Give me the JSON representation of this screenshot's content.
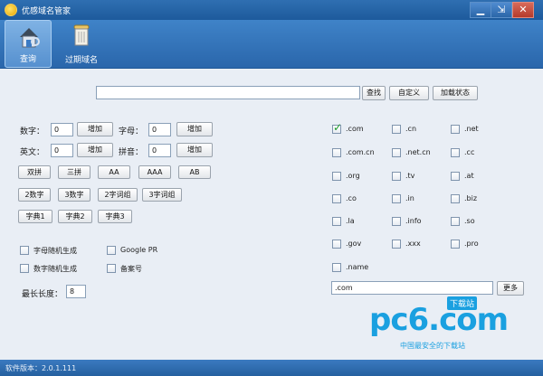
{
  "window": {
    "title": "优感域名管家",
    "min_icon": "minimize-icon",
    "restore_icon": "restore-icon",
    "close_icon": "close-icon"
  },
  "toolbar": {
    "items": [
      {
        "label": "查询",
        "icon": "house-search-icon",
        "active": true
      },
      {
        "label": "过期域名",
        "icon": "trash-can-icon",
        "active": false
      }
    ]
  },
  "search": {
    "value": "",
    "buttons": [
      "查找",
      "自定义",
      "加载状态"
    ]
  },
  "numeric": {
    "digits_label": "数字：",
    "digits_value": "0",
    "letters_label": "字母：",
    "letters_value": "0",
    "english_label": "英文：",
    "english_value": "0",
    "pinyin_label": "拼音：",
    "pinyin_value": "0",
    "add_label": "增加"
  },
  "pattern_buttons": {
    "row1": [
      "双拼",
      "三拼",
      "AA",
      "AAA",
      "AB"
    ],
    "row2": [
      "2数字",
      "3数字",
      "2字词组",
      "3字词组"
    ],
    "row3": [
      "字典1",
      "字典2",
      "字典3"
    ]
  },
  "options": {
    "random_letters": "字母随机生成",
    "random_digits": "数字随机生成",
    "google_pr": "Google PR",
    "beian": "备案号"
  },
  "max_length": {
    "label": "最长长度：",
    "value": "8"
  },
  "tlds": [
    {
      "label": ".com",
      "checked": true
    },
    {
      "label": ".cn",
      "checked": false
    },
    {
      "label": ".net",
      "checked": false
    },
    {
      "label": ".com.cn",
      "checked": false
    },
    {
      "label": ".net.cn",
      "checked": false
    },
    {
      "label": ".cc",
      "checked": false
    },
    {
      "label": ".org",
      "checked": false
    },
    {
      "label": ".tv",
      "checked": false
    },
    {
      "label": ".at",
      "checked": false
    },
    {
      "label": ".co",
      "checked": false
    },
    {
      "label": ".in",
      "checked": false
    },
    {
      "label": ".biz",
      "checked": false
    },
    {
      "label": ".la",
      "checked": false
    },
    {
      "label": ".info",
      "checked": false
    },
    {
      "label": ".so",
      "checked": false
    },
    {
      "label": ".gov",
      "checked": false
    },
    {
      "label": ".xxx",
      "checked": false
    },
    {
      "label": ".pro",
      "checked": false
    },
    {
      "label": ".name",
      "checked": false
    }
  ],
  "suffix": {
    "value": ".com",
    "more_label": "更多"
  },
  "watermark": {
    "brand": "pc6.com",
    "badge": "下载站",
    "tagline": "中国最安全的下载站"
  },
  "statusbar": {
    "version": "软件版本：2.0.1.111"
  },
  "colors": {
    "titlebar": "#1d5a9c",
    "toolbar": "#2a66ab",
    "body": "#e9eef5",
    "check": "#1c9b2a",
    "watermark": "#1aa0e0"
  }
}
